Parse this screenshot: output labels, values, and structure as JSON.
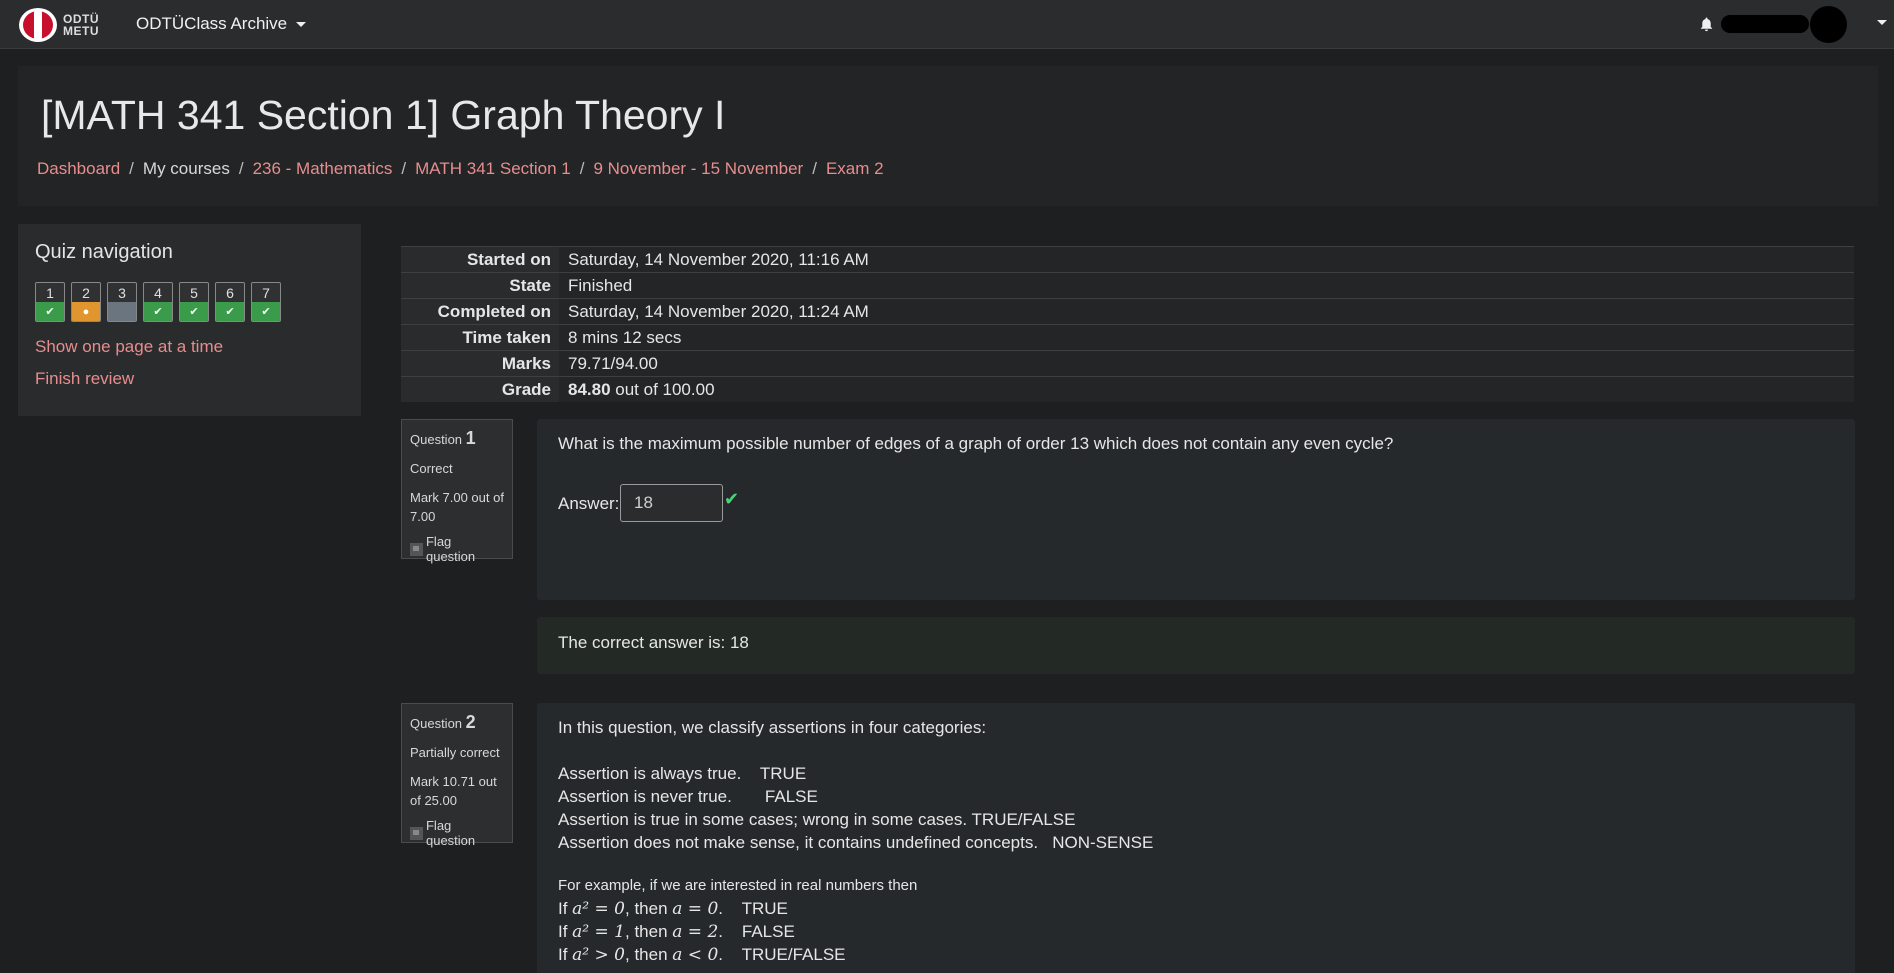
{
  "navbar": {
    "logo_text_1": "ODTÜ",
    "logo_text_2": "METU",
    "site_title": "ODTÜClass Archive",
    "icons": [
      "bell-icon",
      "chevron-down-icon"
    ]
  },
  "header": {
    "title": "[MATH 341 Section 1] Graph Theory I",
    "breadcrumb": [
      "Dashboard",
      "My courses",
      "236 - Mathematics",
      "MATH 341 Section 1",
      "9 November - 15 November",
      "Exam 2"
    ]
  },
  "quiz_nav": {
    "title": "Quiz navigation",
    "buttons": [
      {
        "num": "1",
        "state": "correct"
      },
      {
        "num": "2",
        "state": "partial"
      },
      {
        "num": "3",
        "state": "notyet"
      },
      {
        "num": "4",
        "state": "correct"
      },
      {
        "num": "5",
        "state": "correct"
      },
      {
        "num": "6",
        "state": "correct"
      },
      {
        "num": "7",
        "state": "correct"
      }
    ],
    "show_one_page": "Show one page at a time",
    "finish_review": "Finish review"
  },
  "summary": [
    {
      "label": "Started on",
      "value": "Saturday, 14 November 2020, 11:16 AM"
    },
    {
      "label": "State",
      "value": "Finished"
    },
    {
      "label": "Completed on",
      "value": "Saturday, 14 November 2020, 11:24 AM"
    },
    {
      "label": "Time taken",
      "value": "8 mins 12 secs"
    },
    {
      "label": "Marks",
      "value": "79.71/94.00"
    },
    {
      "label": "Grade",
      "value_bold": "84.80",
      "value_rest": " out of 100.00"
    }
  ],
  "questions": [
    {
      "prefix": "Question ",
      "number": "1",
      "status": "Correct",
      "mark": "Mark 7.00 out of 7.00",
      "flag": "Flag question",
      "text": "What is the maximum possible number of edges of a graph of order 13 which does not contain any even cycle?",
      "answer_label": "Answer:",
      "answer_value": "18",
      "feedback": "The correct answer is: 18"
    },
    {
      "prefix": "Question ",
      "number": "2",
      "status": "Partially correct",
      "mark": "Mark 10.71 out of 25.00",
      "flag": "Flag question",
      "intro": "In this question, we classify assertions in four categories:",
      "categories": [
        "Assertion is always true.    TRUE",
        "Assertion is never true.       FALSE",
        "Assertion is true in some cases; wrong in some cases. TRUE/FALSE",
        "Assertion does not make sense, it contains undefined concepts.   NON-SENSE"
      ],
      "example_intro": "For example, if we are interested in real numbers then",
      "examples": [
        {
          "lead": "If ",
          "cond": "a² = 0",
          "mid": ", then ",
          "res": "a = 0",
          "tail": ".    TRUE"
        },
        {
          "lead": "If ",
          "cond": "a² = 1",
          "mid": ", then ",
          "res": "a = 2",
          "tail": ".    FALSE"
        },
        {
          "lead": "If ",
          "cond": "a² > 0",
          "mid": ", then ",
          "res": "a < 0",
          "tail": ".    TRUE/FALSE"
        }
      ]
    }
  ]
}
